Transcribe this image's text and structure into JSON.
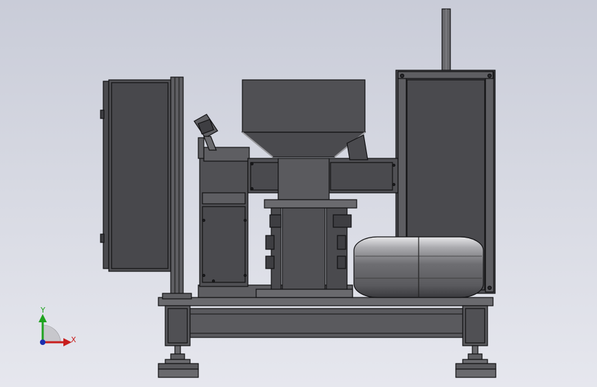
{
  "axis_triad": {
    "y_label": "Y",
    "x_label": "X",
    "y_color": "#1fa31f",
    "x_color": "#c81e1e",
    "origin_color": "#1a2fb0"
  },
  "palette": {
    "body_fill": "#5a5a5e",
    "dark_fill": "#3e3e42",
    "edge": "#111113",
    "highlight": "#8a8a8f"
  }
}
